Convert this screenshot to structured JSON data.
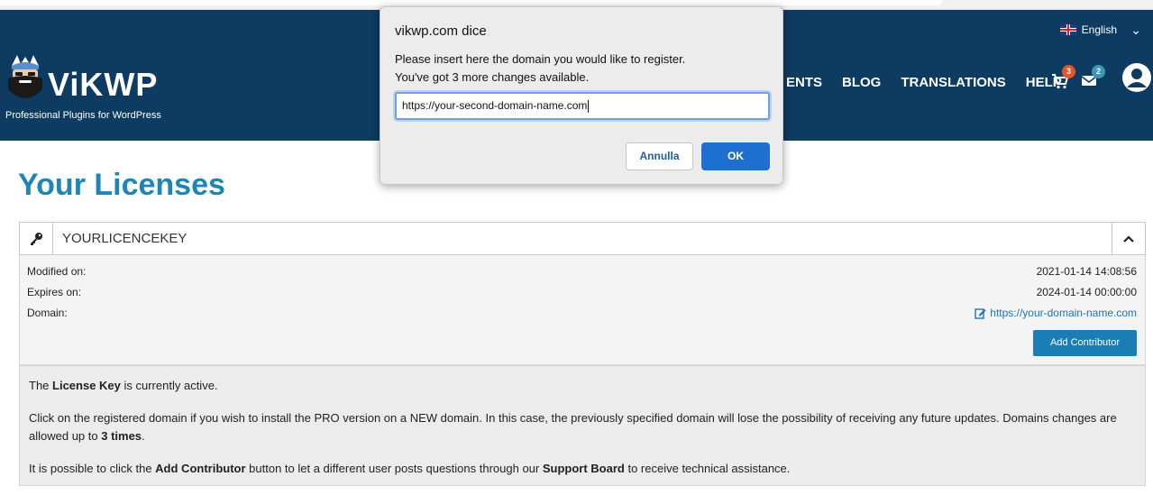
{
  "header": {
    "language": "English",
    "logo_text": "ViKWP",
    "tagline": "Professional Plugins for WordPress",
    "nav": [
      "ENTS",
      "BLOG",
      "TRANSLATIONS",
      "HELP"
    ],
    "cart_count": "3",
    "messages_count": "2",
    "colors": {
      "background": "#0e3b62",
      "cart_badge": "#e8542a",
      "messages_badge": "#3b97b8"
    }
  },
  "page": {
    "title": "Your Licenses"
  },
  "license": {
    "key": "YOURLICENCEKEY",
    "modified_label": "Modified on:",
    "modified_value": "2021-01-14 14:08:56",
    "expires_label": "Expires on:",
    "expires_value": "2024-01-14 00:00:00",
    "domain_label": "Domain:",
    "domain_value": "https://your-domain-name.com",
    "add_contributor": "Add Contributor"
  },
  "info": {
    "p1_a": "The ",
    "p1_b": "License Key",
    "p1_c": " is currently active.",
    "p2_a": "Click on the registered domain if you wish to install the PRO version on a NEW domain. In this case, the previously specified domain will lose the possibility of receiving any future updates. Domains changes are allowed up to ",
    "p2_b": "3 times",
    "p2_c": ".",
    "p3_a": "It is possible to click the ",
    "p3_b": "Add Contributor",
    "p3_c": " button to let a different user posts questions through our ",
    "p3_d": "Support Board",
    "p3_e": " to receive technical assistance."
  },
  "dialog": {
    "title": "vikwp.com dice",
    "message_line1": "Please insert here the domain you would like to register.",
    "message_line2": "You've got 3 more changes available.",
    "input_value": "https://your-second-domain-name.com",
    "cancel_label": "Annulla",
    "ok_label": "OK"
  }
}
